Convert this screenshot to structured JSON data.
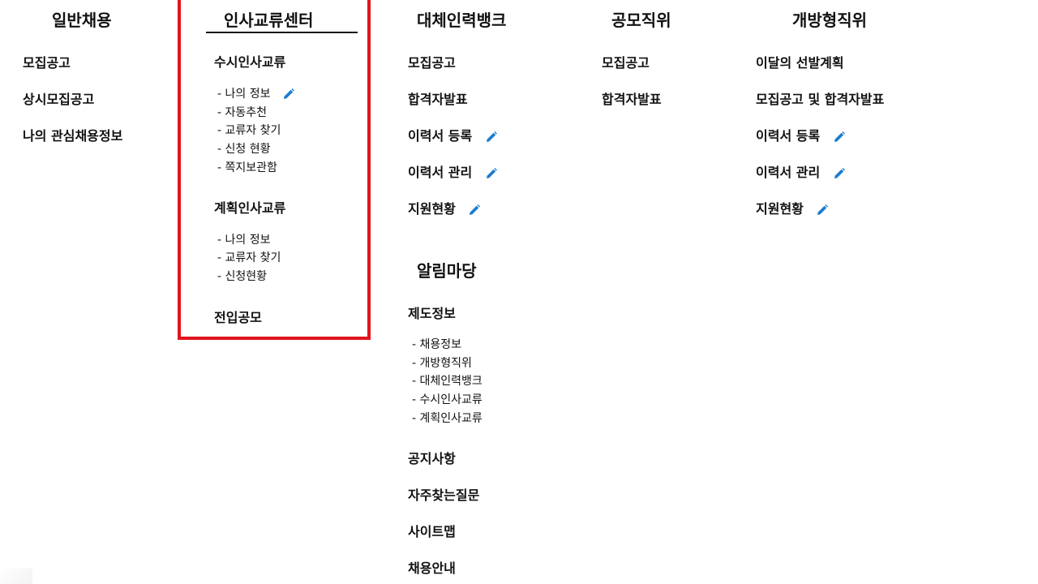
{
  "columns": {
    "general": {
      "title": "일반채용",
      "items": [
        "모집공고",
        "상시모집공고",
        "나의 관심채용정보"
      ]
    },
    "exchange": {
      "title": "인사교류센터",
      "sections": [
        {
          "label": "수시인사교류",
          "subitems": [
            "- 나의 정보",
            "- 자동추천",
            "- 교류자 찾기",
            "- 신청 현황",
            "- 쪽지보관함"
          ]
        },
        {
          "label": "계획인사교류",
          "subitems": [
            "- 나의 정보",
            "- 교류자 찾기",
            "- 신청현황"
          ]
        }
      ],
      "transfer": "전입공모"
    },
    "bank": {
      "title": "대체인력뱅크",
      "items": [
        "모집공고",
        "합격자발표",
        "이력서 등록",
        "이력서 관리",
        "지원현황"
      ]
    },
    "notice": {
      "title": "알림마당",
      "system_info": "제도정보",
      "subitems": [
        "- 채용정보",
        "- 개방형직위",
        "- 대체인력뱅크",
        "- 수시인사교류",
        "- 계획인사교류"
      ],
      "items": [
        "공지사항",
        "자주찾는질문",
        "사이트맵",
        "채용안내"
      ]
    },
    "public": {
      "title": "공모직위",
      "items": [
        "모집공고",
        "합격자발표"
      ]
    },
    "open": {
      "title": "개방형직위",
      "items": [
        "이달의 선발계획",
        "모집공고 및 합격자발표",
        "이력서 등록",
        "이력서 관리",
        "지원현황"
      ]
    }
  },
  "colors": {
    "highlight": "#e2141c",
    "pencil": "#1a7bd0"
  },
  "icons": {
    "edit": "pencil-icon"
  }
}
